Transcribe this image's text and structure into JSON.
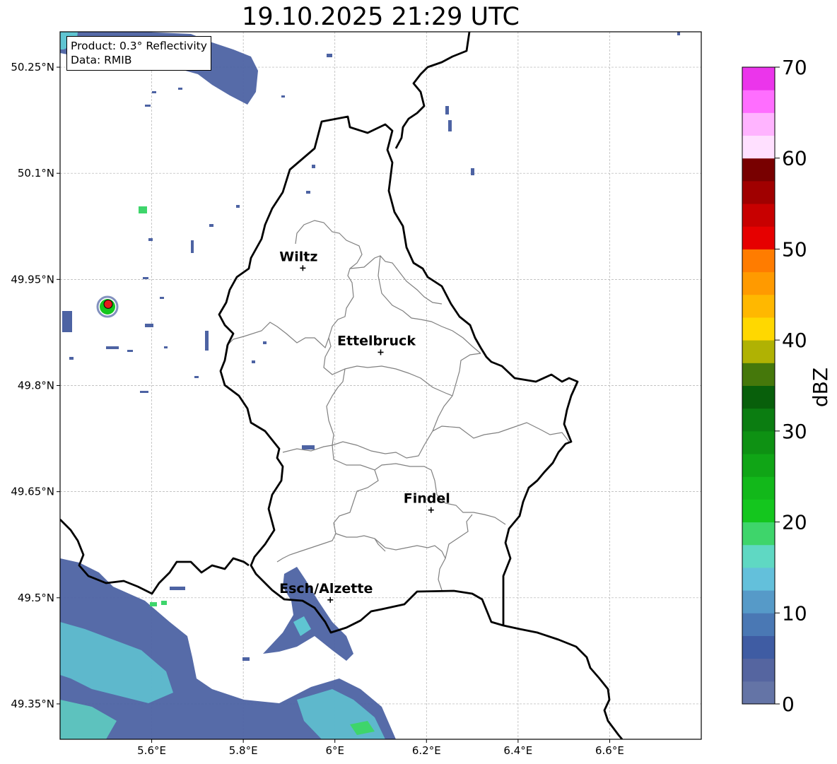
{
  "title": "19.10.2025 21:29 UTC",
  "info": {
    "product": "Product: 0.3° Reflectivity",
    "data": "Data: RMIB"
  },
  "map": {
    "lon_range": [
      5.4,
      6.8
    ],
    "lat_range": [
      49.3,
      50.3
    ],
    "lon_ticks": [
      {
        "value": 5.6,
        "label": "5.6°E"
      },
      {
        "value": 5.8,
        "label": "5.8°E"
      },
      {
        "value": 6.0,
        "label": "6°E"
      },
      {
        "value": 6.2,
        "label": "6.2°E"
      },
      {
        "value": 6.4,
        "label": "6.4°E"
      },
      {
        "value": 6.6,
        "label": "6.6°E"
      }
    ],
    "lat_ticks": [
      {
        "value": 50.25,
        "label": "50.25°N"
      },
      {
        "value": 50.1,
        "label": "50.1°N"
      },
      {
        "value": 49.95,
        "label": "49.95°N"
      },
      {
        "value": 49.8,
        "label": "49.8°N"
      },
      {
        "value": 49.65,
        "label": "49.65°N"
      },
      {
        "value": 49.5,
        "label": "49.5°N"
      },
      {
        "value": 49.35,
        "label": "49.35°N"
      }
    ],
    "cities": [
      {
        "name": "Wiltz",
        "lon": 5.93,
        "lat": 49.966
      },
      {
        "name": "Ettelbruck",
        "lon": 6.1,
        "lat": 49.847
      },
      {
        "name": "Findel",
        "lon": 6.21,
        "lat": 49.624
      },
      {
        "name": "Esch/Alzette",
        "lon": 5.99,
        "lat": 49.497
      }
    ],
    "radar_site": {
      "lon": 5.505,
      "lat": 49.915,
      "color": "#e31a1c"
    }
  },
  "colorbar": {
    "label": "dBZ",
    "min": 0,
    "max": 70,
    "ticks": [
      0,
      10,
      20,
      30,
      40,
      50,
      60,
      70
    ],
    "colors": [
      "#6474a6",
      "#5565a0",
      "#3f5ca3",
      "#4a78b4",
      "#569ac8",
      "#63c0db",
      "#5fd8c3",
      "#3ed56b",
      "#14c61e",
      "#12b81a",
      "#10a516",
      "#0e9113",
      "#0b7d11",
      "#085f0b",
      "#45780b",
      "#b0b203",
      "#ffd800",
      "#ffb800",
      "#ff9a00",
      "#ff7c00",
      "#e60000",
      "#c80000",
      "#a00000",
      "#780000",
      "#ffe0ff",
      "#ffb4ff",
      "#ff6eff",
      "#eb35eb"
    ]
  }
}
